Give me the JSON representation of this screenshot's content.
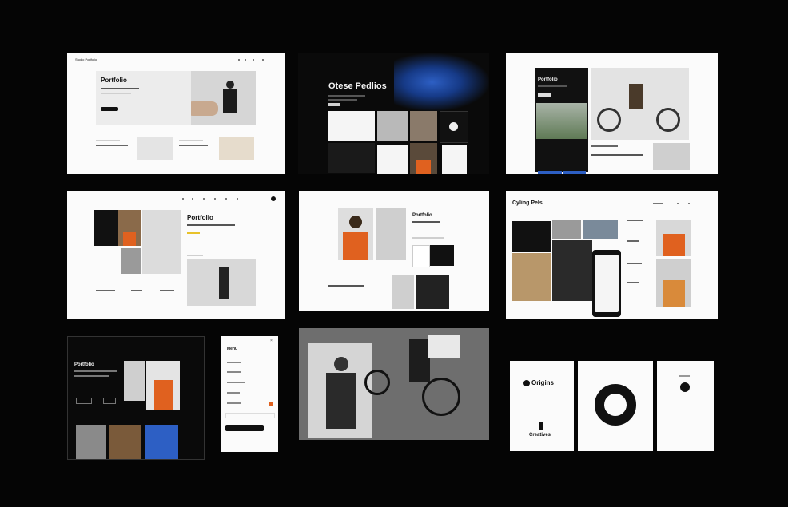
{
  "mockups": {
    "c1": {
      "logo": "Studio Portfolio",
      "headline": "Portfolio"
    },
    "c2": {
      "headline": "Otese Pedlios"
    },
    "c3": {
      "headline": "Portfolio"
    },
    "c4": {
      "headline": "Portfolio"
    },
    "c5": {
      "headline": "Portfolio"
    },
    "c6": {
      "headline": "Cyling Pels"
    },
    "c7": {
      "headline": "Portfolio"
    },
    "c8": {
      "headline": "Menu"
    },
    "c10": {
      "logo_text": "Origins",
      "footer_text": "Creatives"
    }
  },
  "colors": {
    "background": "#050505",
    "orange_accent": "#e0611f",
    "blue_accent": "#2d5fc4"
  }
}
